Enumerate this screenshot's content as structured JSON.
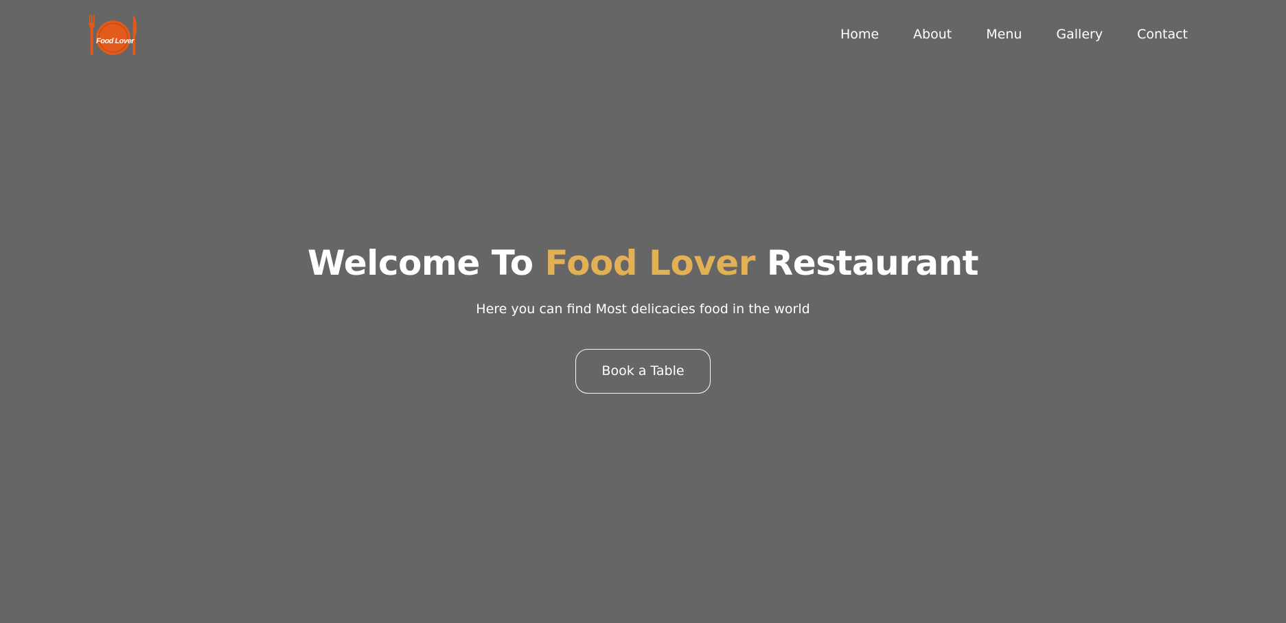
{
  "brand": {
    "logo_text": "Food Lover",
    "logo_icon": "plate-fork-knife-logo",
    "logo_color": "#e25a1c"
  },
  "nav": {
    "items": [
      {
        "label": "Home"
      },
      {
        "label": "About"
      },
      {
        "label": "Menu"
      },
      {
        "label": "Gallery"
      },
      {
        "label": "Contact"
      }
    ]
  },
  "hero": {
    "title_prefix": "Welcome To ",
    "title_accent": "Food Lover",
    "title_suffix": " Restaurant",
    "subtitle": "Here you can find Most delicacies food in the world",
    "cta_label": "Book a Table"
  },
  "colors": {
    "background": "#666666",
    "accent": "#e2b155",
    "text": "#ffffff"
  }
}
